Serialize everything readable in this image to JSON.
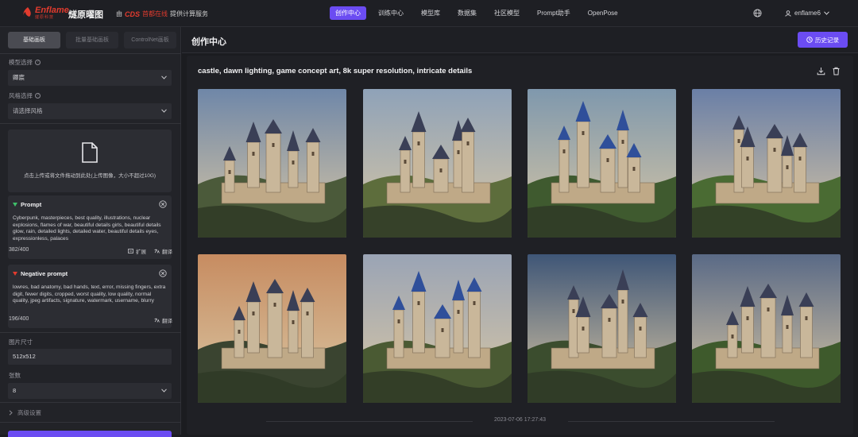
{
  "brand": {
    "logo_text": "Enflame",
    "logo_sub": "燧原科技",
    "product_name": "燧原曜图",
    "sponsor_prefix": "由",
    "sponsor_brand": "CDS",
    "sponsor_brand_cn": "首都在线",
    "sponsor_suffix": "提供计算服务"
  },
  "nav": {
    "items": [
      {
        "label": "创作中心",
        "active": true
      },
      {
        "label": "训练中心",
        "active": false
      },
      {
        "label": "模型库",
        "active": false
      },
      {
        "label": "数据集",
        "active": false
      },
      {
        "label": "社区模型",
        "active": false
      },
      {
        "label": "Prompt助手",
        "active": false
      },
      {
        "label": "OpenPose",
        "active": false
      }
    ],
    "globe_icon": "globe-icon",
    "username": "enflame6"
  },
  "sidebar": {
    "tabs": [
      {
        "label": "基础画板",
        "active": true
      },
      {
        "label": "批量基础画板",
        "active": false
      },
      {
        "label": "ControlNet画板",
        "active": false
      }
    ],
    "model_label": "模型选择",
    "model_value": "卿宸",
    "style_label": "风格选择",
    "style_value": "请选择风格",
    "upload_text": "点击上传或将文件拖动到此处(上传图像，大小不超过10G)",
    "prompt": {
      "title": "Prompt",
      "text": "Cyberpunk, masterpieces, best quality, illustrations, nuclear explosions, flames of war, beautiful details girls, beautiful details glow, rain, detailed lights, detailed water, beautiful details eyes, expressionless, palaces",
      "count": "382/400",
      "expand_label": "扩展",
      "translate_label": "翻译"
    },
    "negative_prompt": {
      "title": "Negative prompt",
      "text": "lowres, bad anatomy, bad hands, text, error, missing fingers, extra digit, fewer digits, cropped, worst quality, low quality, normal quality, jpeg artifacts, signature, watermark, username, blurry",
      "count": "196/400",
      "translate_label": "翻译"
    },
    "size_label": "图片尺寸",
    "size_value": "512x512",
    "count_label": "张数",
    "count_value": "8",
    "advanced_label": "高级设置"
  },
  "main": {
    "title": "创作中心",
    "history_button": "历史记录",
    "prompt_title": "castle, dawn lighting, game concept art, 8k super resolution, intricate details",
    "timestamp": "2023-07-06 17:27:43",
    "images": [
      {
        "name": "castle-image-1",
        "sky": "#6f87a8",
        "ground": "#4b5a3a"
      },
      {
        "name": "castle-image-2",
        "sky": "#8fa2b8",
        "ground": "#5d6d3c"
      },
      {
        "name": "castle-image-3",
        "sky": "#7f98ad",
        "ground": "#3f5a2f"
      },
      {
        "name": "castle-image-4",
        "sky": "#6a7fa6",
        "ground": "#4a6b33"
      },
      {
        "name": "castle-image-5",
        "sky": "#c78c61",
        "ground": "#3a4430"
      },
      {
        "name": "castle-image-6",
        "sky": "#9aa4b5",
        "ground": "#4a5a33"
      },
      {
        "name": "castle-image-7",
        "sky": "#3f5677",
        "ground": "#3b4d2e"
      },
      {
        "name": "castle-image-8",
        "sky": "#5a6a86",
        "ground": "#3e5a2c"
      }
    ]
  },
  "colors": {
    "accent": "#6b4cf2",
    "brand_red": "#e23b2e"
  }
}
